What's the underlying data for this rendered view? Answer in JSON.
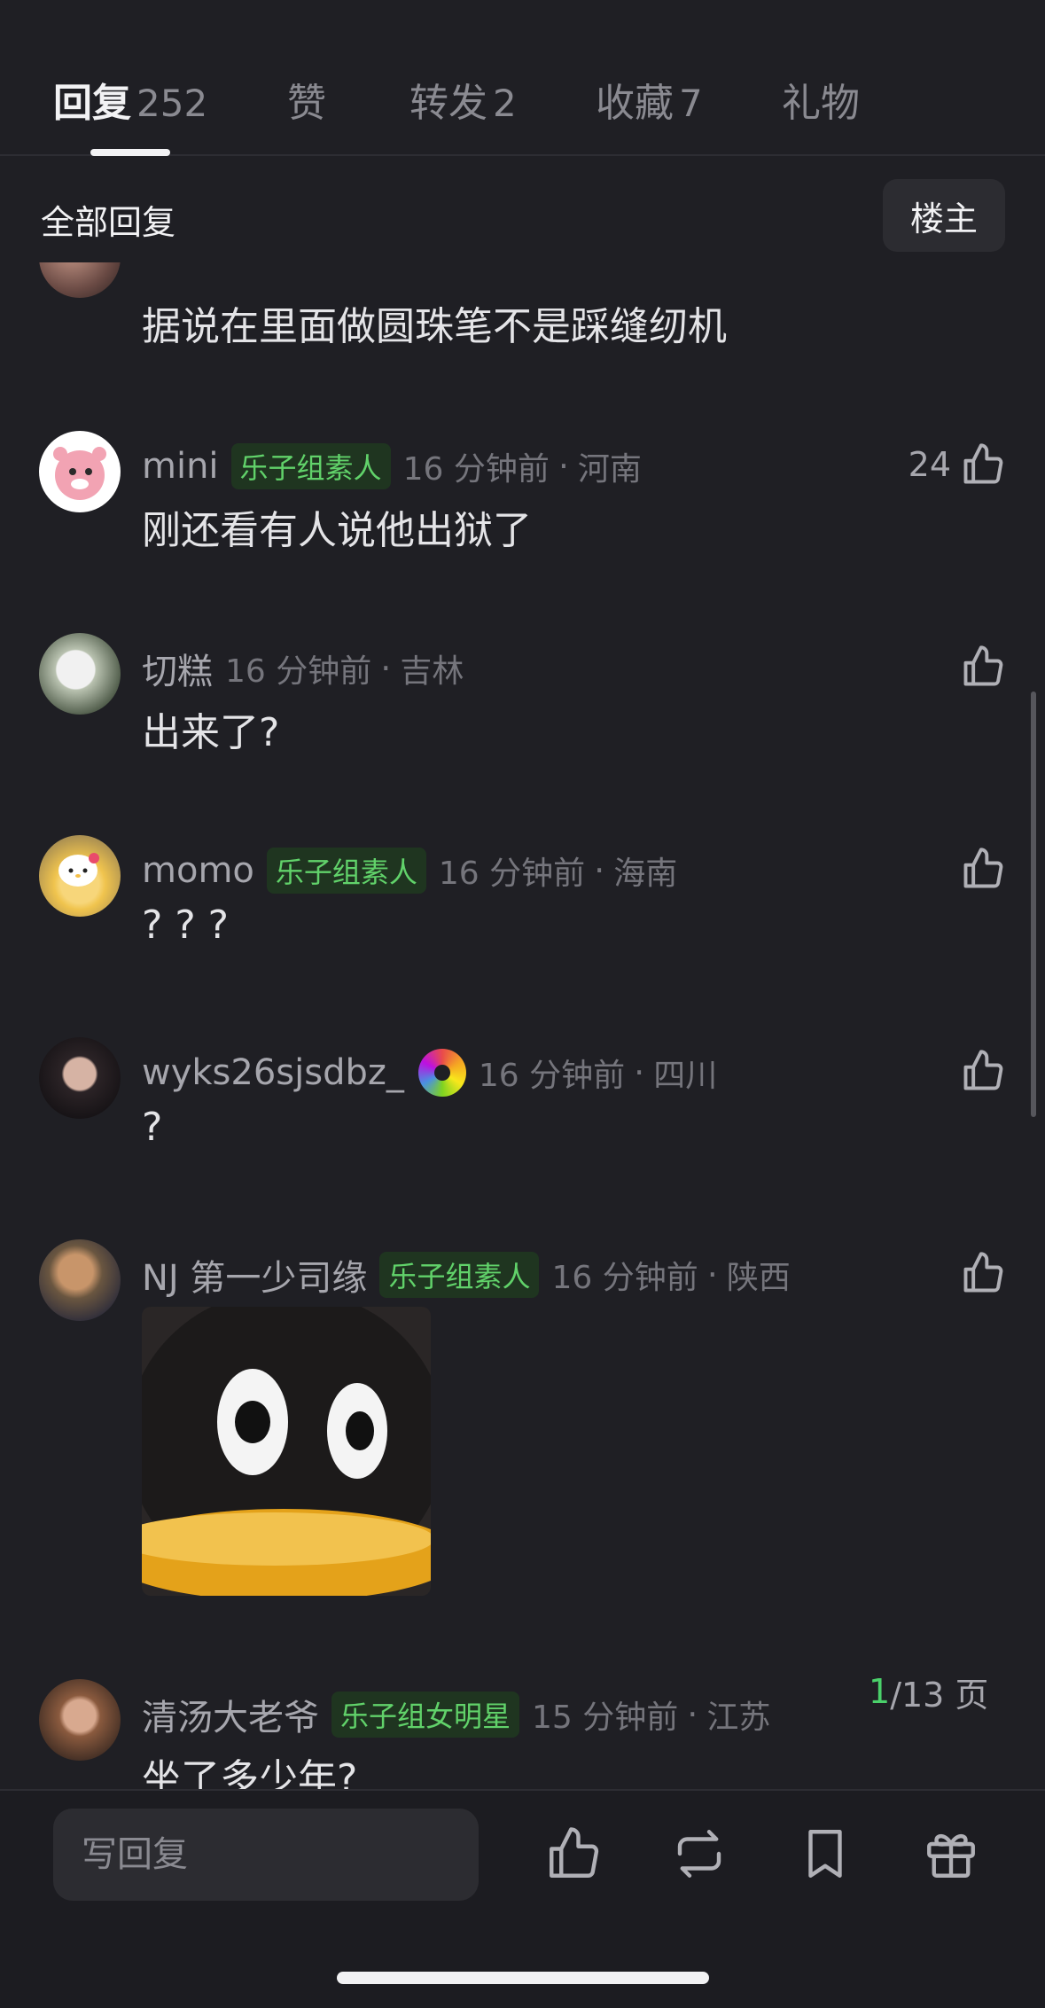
{
  "tabs": [
    {
      "name": "回复",
      "count": "252",
      "active": true
    },
    {
      "name": "赞",
      "count": "",
      "active": false
    },
    {
      "name": "转发",
      "count": "2",
      "active": false
    },
    {
      "name": "收藏",
      "count": "7",
      "active": false
    },
    {
      "name": "礼物",
      "count": "",
      "active": false
    }
  ],
  "filter": {
    "title": "全部回复",
    "op_button": "楼主"
  },
  "comments": [
    {
      "username": "",
      "badge": "",
      "time": "",
      "location": "",
      "text": "据说在里面做圆珠笔不是踩缝纫机",
      "likes": ""
    },
    {
      "username": "mini",
      "badge": "乐子组素人",
      "time": "16 分钟前",
      "location": "河南",
      "text": "刚还看有人说他出狱了",
      "likes": "24"
    },
    {
      "username": "切糕",
      "badge": "",
      "time": "16 分钟前",
      "location": "吉林",
      "text": "出来了?",
      "likes": ""
    },
    {
      "username": "momo",
      "badge": "乐子组素人",
      "time": "16 分钟前",
      "location": "海南",
      "text": "? ? ?",
      "likes": ""
    },
    {
      "username": "wyks26sjsdbz_",
      "badge": "",
      "time": "16 分钟前",
      "location": "四川",
      "text": "?",
      "likes": ""
    },
    {
      "username": "NJ 第一少司缘",
      "badge": "乐子组素人",
      "time": "16 分钟前",
      "location": "陕西",
      "text": "",
      "likes": ""
    },
    {
      "username": "清汤大老爷",
      "badge": "乐子组女明星",
      "time": "15 分钟前",
      "location": "江苏",
      "text": "坐了多少年?",
      "likes": ""
    }
  ],
  "pager": {
    "current": "1",
    "total": "/13 页"
  },
  "bottom_bar": {
    "reply_placeholder": "写回复"
  },
  "colors": {
    "background": "#1f1f24",
    "badge_green": "#61d26a",
    "pager_green": "#4ad06a"
  }
}
